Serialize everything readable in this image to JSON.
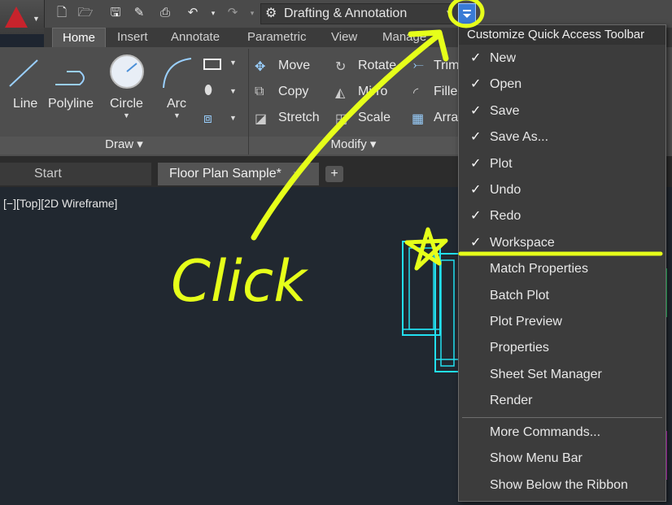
{
  "qat": {
    "workspace": "Drafting & Annotation",
    "icons": [
      "new-icon",
      "open-icon",
      "save-icon",
      "save-as-icon",
      "plot-icon",
      "undo-icon",
      "redo-icon"
    ]
  },
  "ribbon": {
    "tabs": [
      "Home",
      "Insert",
      "Annotate",
      "Parametric",
      "View",
      "Manage"
    ],
    "draw": {
      "line": "Line",
      "polyline": "Polyline",
      "circle": "Circle",
      "arc": "Arc",
      "panel": "Draw ▾"
    },
    "modify": {
      "move": "Move",
      "rotate": "Rotate",
      "copy": "Copy",
      "mirror": "Mirro",
      "stretch": "Stretch",
      "scale": "Scale",
      "trim": "Trim",
      "fillet": "Fille",
      "array": "Arra",
      "panel": "Modify ▾"
    }
  },
  "doc_tabs": {
    "start": "Start",
    "floor": "Floor Plan Sample*",
    "close": "×",
    "plus": "+"
  },
  "viewport_label": "[−][Top][2D Wireframe]",
  "menu": {
    "title": "Customize Quick Access Toolbar",
    "check": "✓",
    "items": [
      {
        "label": "New",
        "checked": true
      },
      {
        "label": "Open",
        "checked": true
      },
      {
        "label": "Save",
        "checked": true
      },
      {
        "label": "Save As...",
        "checked": true
      },
      {
        "label": "Plot",
        "checked": true
      },
      {
        "label": "Undo",
        "checked": true
      },
      {
        "label": "Redo",
        "checked": true
      },
      {
        "label": "Workspace",
        "checked": true
      },
      {
        "label": "Match Properties",
        "checked": false
      },
      {
        "label": "Batch Plot",
        "checked": false
      },
      {
        "label": "Plot Preview",
        "checked": false
      },
      {
        "label": "Properties",
        "checked": false
      },
      {
        "label": "Sheet Set Manager",
        "checked": false
      },
      {
        "label": "Render",
        "checked": false
      }
    ],
    "extra": [
      "More Commands...",
      "Show Menu Bar",
      "Show Below the Ribbon"
    ]
  },
  "annotation": {
    "text": "Click",
    "color": "#e6ff1a"
  }
}
